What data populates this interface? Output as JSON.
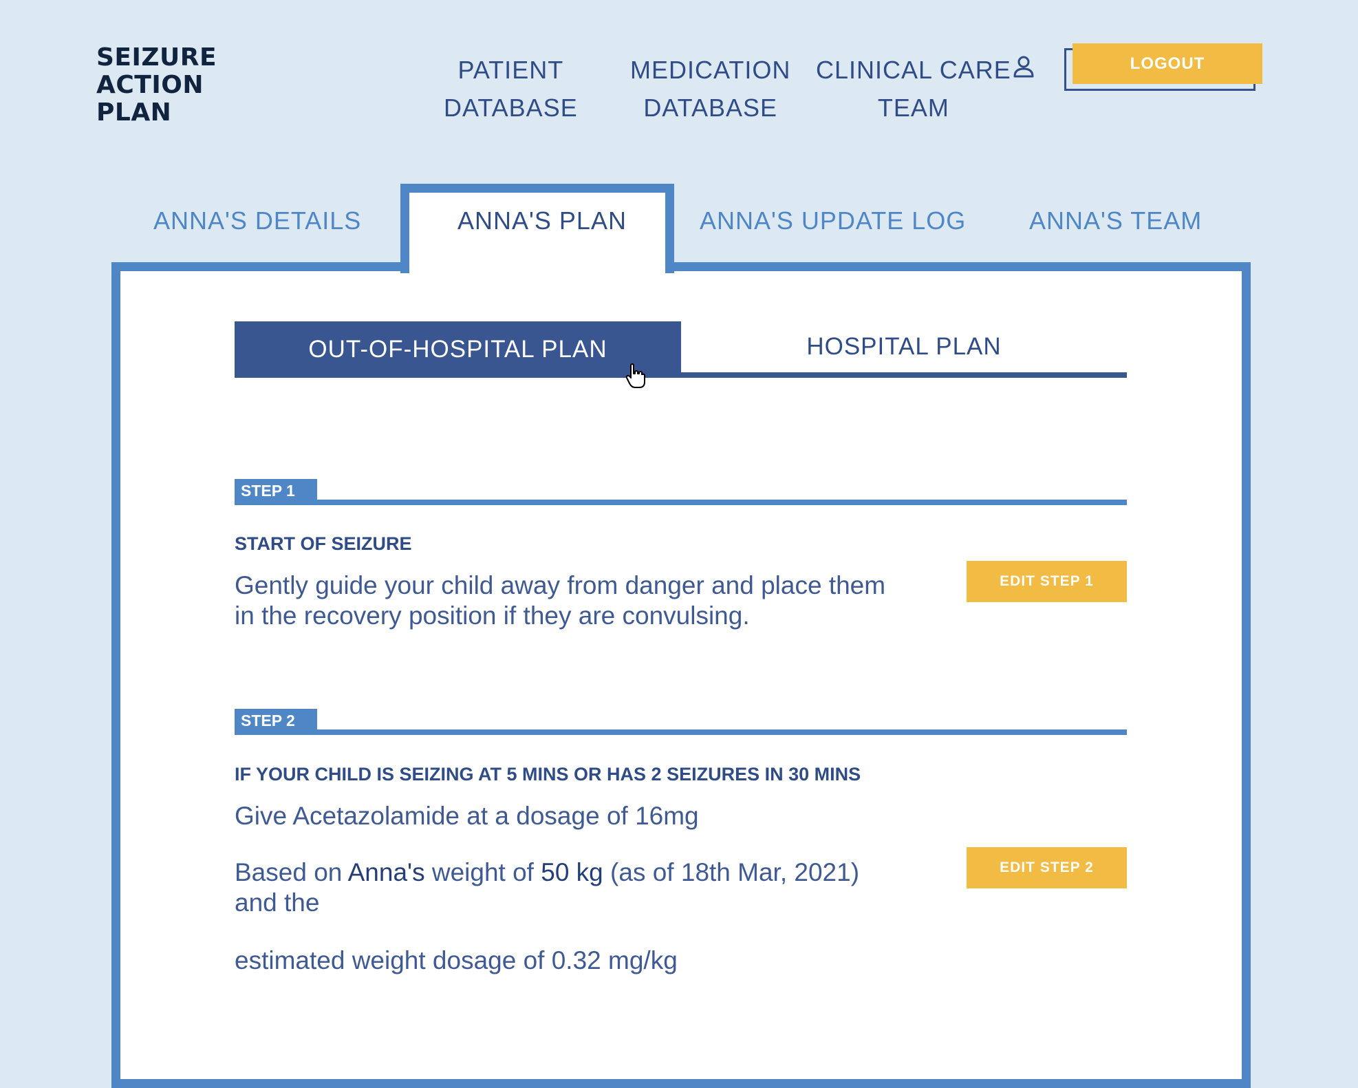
{
  "logo": {
    "line1": "SEIZURE",
    "line2": "ACTION",
    "line3": "PLAN"
  },
  "nav": {
    "patient_db_line1": "PATIENT",
    "patient_db_line2": "DATABASE",
    "medication_db_line1": "MEDICATION",
    "medication_db_line2": "DATABASE",
    "clinical_care_line1": "CLINICAL CARE",
    "clinical_care_line2": "TEAM",
    "logout_label": "LOGOUT"
  },
  "tabs": {
    "details": "ANNA'S DETAILS",
    "plan": "ANNA'S PLAN",
    "update_log": "ANNA'S UPDATE LOG",
    "team": "ANNA'S TEAM"
  },
  "subtabs": {
    "out_of_hospital": "OUT-OF-HOSPITAL PLAN",
    "hospital": "HOSPITAL PLAN"
  },
  "step1": {
    "badge": "STEP 1",
    "title": "START OF SEIZURE",
    "text_line1": "Gently guide your child away from danger and place them",
    "text_line2": "in the recovery position if they are convulsing.",
    "edit_label": "EDIT STEP 1"
  },
  "step2": {
    "badge": "STEP 2",
    "title": "IF YOUR CHILD IS SEIZING AT 5 MINS OR HAS 2 SEIZURES IN 30 MINS",
    "dose_text": "Give Acetazolamide at a dosage of 16mg",
    "based_on": "Based on",
    "patient_name": "Anna's",
    "weight_of": "weight of",
    "weight": "50 kg",
    "as_of": "(as of 18th Mar, 2021)",
    "and_the": "and the",
    "estimated": "estimated weight dosage of 0.32 mg/kg",
    "edit_label": "EDIT STEP 2"
  },
  "colors": {
    "background": "#dce8f2",
    "accent_blue": "#4f86c6",
    "navy": "#3a5690",
    "yellow": "#f2bb43"
  }
}
